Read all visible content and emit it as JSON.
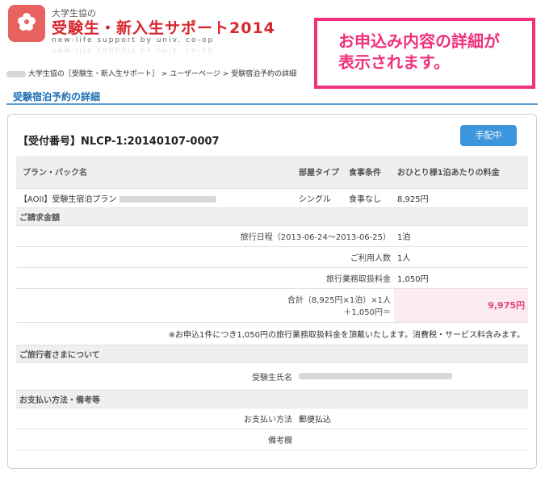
{
  "header": {
    "brand_small": "大学生協の",
    "brand_main": "受験生・新入生サポート2014",
    "brand_sub": "new-life support by univ. co-op"
  },
  "callout": {
    "line1": "お申込み内容の詳細が",
    "line2": "表示されます。"
  },
  "breadcrumb": {
    "part1": "大学生協の［受験生・新入生サポート］",
    "sep": ">",
    "part2": "ユーザーページ",
    "part3": "受験宿泊予約の詳細"
  },
  "page_title": "受験宿泊予約の詳細",
  "reservation": {
    "ref_label": "【受付番号】NLCP-1:20140107-0007",
    "status": "手配中"
  },
  "plan_table": {
    "headers": [
      "プラン・パック名",
      "部屋タイプ",
      "食事条件",
      "おひとり様1泊あたりの料金"
    ],
    "row": {
      "plan": "【AOII】受験生宿泊プラン",
      "room": "シングル",
      "meal": "食事なし",
      "price": "8,925円"
    }
  },
  "billing": {
    "section_title": "ご請求金額",
    "rows": [
      {
        "label": "旅行日程（2013-06-24〜2013-06-25）",
        "value": "1泊"
      },
      {
        "label": "ご利用人数",
        "value": "1人"
      },
      {
        "label": "旅行業務取扱料金",
        "value": "1,050円"
      }
    ],
    "total_label_line1": "合計（8,925円×1泊）×1人",
    "total_label_line2": "＋1,050円＝",
    "total_value": "9,975円",
    "note": "※お申込1件につき1,050円の旅行業務取扱料金を頂戴いたします。消費税・サービス料含みます。"
  },
  "traveler": {
    "section_title": "ご旅行者さまについて",
    "name_label": "受験生氏名"
  },
  "payment": {
    "section_title": "お支払い方法・備考等",
    "method_label": "お支払い方法",
    "method_value": "郵便払込",
    "notes_label": "備考欄"
  }
}
